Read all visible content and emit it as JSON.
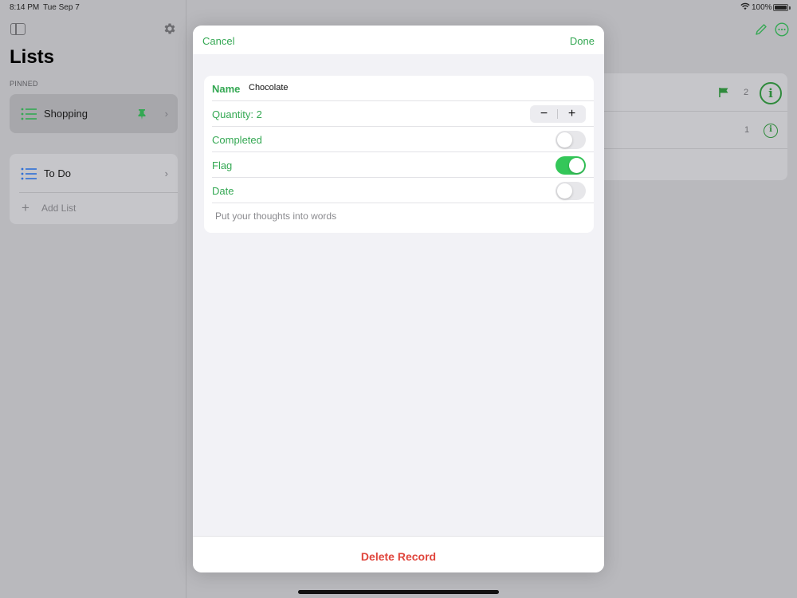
{
  "status_bar": {
    "time": "8:14 PM",
    "date": "Tue Sep 7",
    "battery_percent": "100%",
    "icons": [
      "wifi-icon",
      "battery-icon"
    ]
  },
  "sidebar": {
    "title": "Lists",
    "pinned_label": "PINNED",
    "pinned_items": [
      {
        "label": "Shopping",
        "icon": "list-icon",
        "pinned": true
      }
    ],
    "items": [
      {
        "label": "To Do",
        "icon": "list-icon"
      }
    ],
    "add_list_label": "Add List",
    "icons": [
      "sidebar-toggle-icon",
      "gear-icon",
      "pin-icon",
      "chevron-right-icon",
      "plus-icon"
    ]
  },
  "detail": {
    "rows": [
      {
        "count": "2",
        "flagged": true
      },
      {
        "count": "1",
        "flagged": false
      }
    ],
    "icons": [
      "pencil-icon",
      "more-icon",
      "flag-icon",
      "info-icon"
    ]
  },
  "modal": {
    "cancel_label": "Cancel",
    "done_label": "Done",
    "name_label": "Name",
    "name_value": "Chocolate",
    "quantity_label": "Quantity: 2",
    "quantity": 2,
    "stepper_minus": "−",
    "stepper_plus": "+",
    "completed_label": "Completed",
    "completed": false,
    "flag_label": "Flag",
    "flag": true,
    "date_label": "Date",
    "date": false,
    "notes_placeholder": "Put your thoughts into words",
    "delete_label": "Delete Record"
  },
  "colors": {
    "accent": "#34a853",
    "toggle_on": "#34c759",
    "destructive": "#e0453c",
    "list_blue": "#2f6fd6"
  }
}
